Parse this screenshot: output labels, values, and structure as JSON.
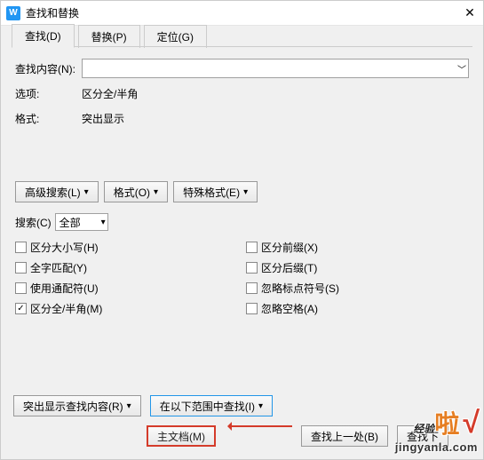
{
  "window": {
    "title": "查找和替换"
  },
  "tabs": {
    "find": "查找(D)",
    "replace": "替换(P)",
    "goto": "定位(G)"
  },
  "fields": {
    "findwhat_label": "查找内容(N):",
    "options_label": "选项:",
    "options_value": "区分全/半角",
    "format_label": "格式:",
    "format_value": "突出显示"
  },
  "buttons": {
    "advanced": "高级搜索(L)",
    "format": "格式(O)",
    "special": "特殊格式(E)",
    "highlight_all": "突出显示查找内容(R)",
    "find_in": "在以下范围中查找(I)",
    "main_doc": "主文档(M)",
    "find_prev": "查找上一处(B)",
    "find_next": "查找下"
  },
  "search": {
    "label": "搜索(C)",
    "value": "全部"
  },
  "checks": {
    "match_case": "区分大小写(H)",
    "whole_word": "全字匹配(Y)",
    "use_wildcards": "使用通配符(U)",
    "full_half": "区分全/半角(M)",
    "prefix": "区分前缀(X)",
    "suffix": "区分后缀(T)",
    "ignore_punct": "忽略标点符号(S)",
    "ignore_space": "忽略空格(A)"
  },
  "watermark": {
    "line1a": "经验",
    "line1b": "啦",
    "line1c": "√",
    "line2": "jingyanla.com"
  }
}
